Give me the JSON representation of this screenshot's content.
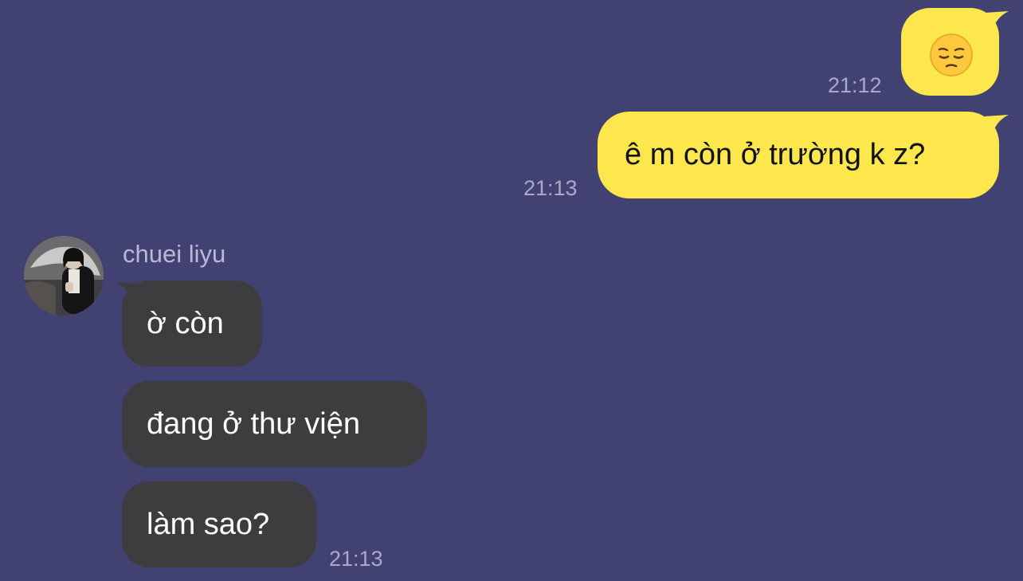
{
  "colors": {
    "background": "#414272",
    "outgoing_bubble": "#fde74c",
    "incoming_bubble": "#3d3d40",
    "timestamp": "#a9a8c9"
  },
  "messages_out": [
    {
      "emoji": "pensive-face-icon",
      "time": "21:12"
    },
    {
      "text": "ê m còn ở trường k z?",
      "time": "21:13"
    }
  ],
  "contact": {
    "name": "chuei liyu",
    "avatar": "contact-avatar"
  },
  "messages_in": [
    {
      "text": "ờ còn"
    },
    {
      "text": "đang ở thư viện"
    },
    {
      "text": "làm sao?",
      "time": "21:13"
    }
  ]
}
